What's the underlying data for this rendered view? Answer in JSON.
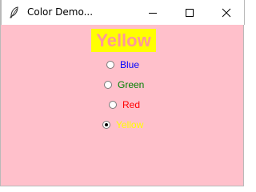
{
  "window": {
    "title": "Color Demo...",
    "background": "#ffc0cb"
  },
  "title_controls": [
    "minimize-icon",
    "maximize-icon",
    "close-icon"
  ],
  "display_label": {
    "text": "Yellow",
    "background": "#ffff00",
    "color": "#ff9999"
  },
  "radio_options": [
    {
      "label": "Blue",
      "color": "#0000ff",
      "selected": false
    },
    {
      "label": "Green",
      "color": "#008000",
      "selected": false
    },
    {
      "label": "Red",
      "color": "#ff0000",
      "selected": false
    },
    {
      "label": "Yellow",
      "color": "#ffff00",
      "selected": true
    }
  ]
}
